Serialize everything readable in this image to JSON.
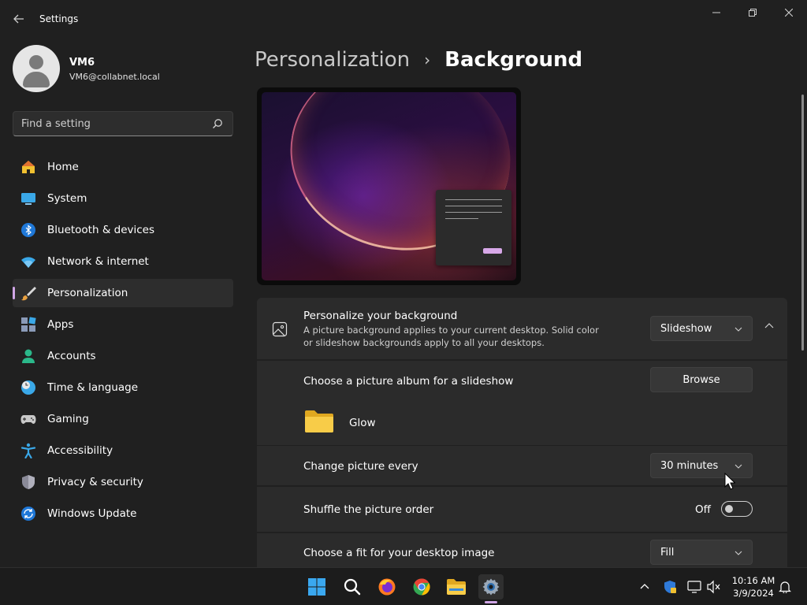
{
  "window": {
    "title": "Settings"
  },
  "user": {
    "name": "VM6",
    "email": "VM6@collabnet.local"
  },
  "search": {
    "placeholder": "Find a setting"
  },
  "nav": {
    "items": [
      {
        "label": "Home",
        "icon": "home-icon"
      },
      {
        "label": "System",
        "icon": "system-icon"
      },
      {
        "label": "Bluetooth & devices",
        "icon": "bluetooth-icon"
      },
      {
        "label": "Network & internet",
        "icon": "wifi-icon"
      },
      {
        "label": "Personalization",
        "icon": "brush-icon",
        "selected": true
      },
      {
        "label": "Apps",
        "icon": "apps-icon"
      },
      {
        "label": "Accounts",
        "icon": "accounts-icon"
      },
      {
        "label": "Time & language",
        "icon": "clock-globe-icon"
      },
      {
        "label": "Gaming",
        "icon": "gamepad-icon"
      },
      {
        "label": "Accessibility",
        "icon": "accessibility-icon"
      },
      {
        "label": "Privacy & security",
        "icon": "shield-icon"
      },
      {
        "label": "Windows Update",
        "icon": "update-icon"
      }
    ]
  },
  "breadcrumb": {
    "parent": "Personalization",
    "separator": "›",
    "current": "Background"
  },
  "background_card": {
    "title": "Personalize your background",
    "description": "A picture background applies to your current desktop. Solid color or slideshow backgrounds apply to all your desktops.",
    "mode": "Slideshow"
  },
  "album": {
    "label": "Choose a picture album for a slideshow",
    "browse_label": "Browse",
    "folder_name": "Glow"
  },
  "change_picture": {
    "label": "Change picture every",
    "value": "30 minutes"
  },
  "shuffle": {
    "label": "Shuffle the picture order",
    "state_label": "Off",
    "on": false
  },
  "fit": {
    "label": "Choose a fit for your desktop image",
    "value": "Fill"
  },
  "taskbar": {
    "apps": [
      "start-icon",
      "search-icon",
      "firefox-icon",
      "chrome-icon",
      "file-explorer-icon",
      "settings-icon"
    ],
    "active_app": "settings-icon",
    "time": "10:16 AM",
    "date": "3/9/2024"
  },
  "colors": {
    "accent": "#d0a6e6",
    "background": "#202020",
    "card": "#2b2b2b"
  }
}
